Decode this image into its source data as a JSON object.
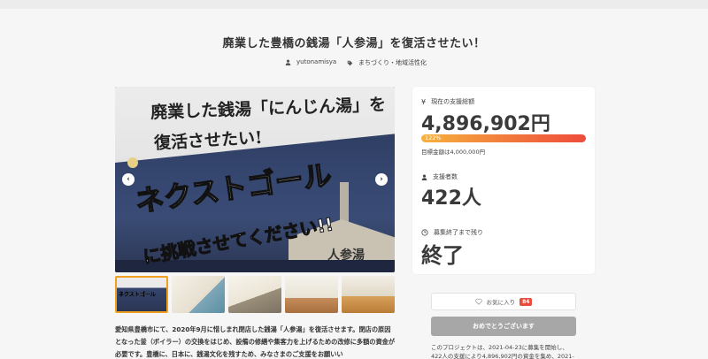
{
  "project": {
    "title": "廃業した豊橋の銭湯「人参湯」を復活させたい！",
    "owner": "yutonamisya",
    "category": "まちづくり・地域活性化"
  },
  "hero": {
    "line1": "廃業した銭湯「にんじん湯」を",
    "line2": "復活させたい!",
    "line3": "ネクストゴール",
    "line4": "に挑戦させてください!!",
    "sign": "人参湯",
    "prev": "‹",
    "next": "›"
  },
  "thumbnails": [
    {
      "label": "ネクストゴール",
      "active": true
    },
    {
      "label": "",
      "active": false
    },
    {
      "label": "",
      "active": false
    },
    {
      "label": "",
      "active": false
    },
    {
      "label": "",
      "active": false
    }
  ],
  "description": "愛知県豊橋市にて、2020年9月に惜しまれ閉店した銭湯「人参湯」を復活させます。閉店の原因となった釜（ボイラー）の交換をはじめ、設備の修繕や集客力を上げるための改修に多額の資金が必要です。豊橋に、日本に、銭湯文化を残すため、みなさまのご支援をお願いい",
  "funding": {
    "current_label": "現在の支援総額",
    "current_amount": "4,896,902円",
    "progress_pct": "122%",
    "progress_value": 122,
    "goal_text": "目標金額は4,000,000円",
    "supporters_label": "支援者数",
    "supporters_value": "422人",
    "remaining_label": "募集終了まで残り",
    "remaining_value": "終了"
  },
  "actions": {
    "favorite_label": "お気に入り",
    "favorite_count": "84",
    "cta_label": "おめでとうございます"
  },
  "notice": "このプロジェクトは、2021-04-23に募集を開始し、422人の支援により4,896,902円の資金を集め、2021-",
  "colors": {
    "progress_start": "#f7b23b",
    "progress_end": "#ee4b3c",
    "badge": "#e84c3c",
    "cta_disabled": "#a7a7a7"
  }
}
